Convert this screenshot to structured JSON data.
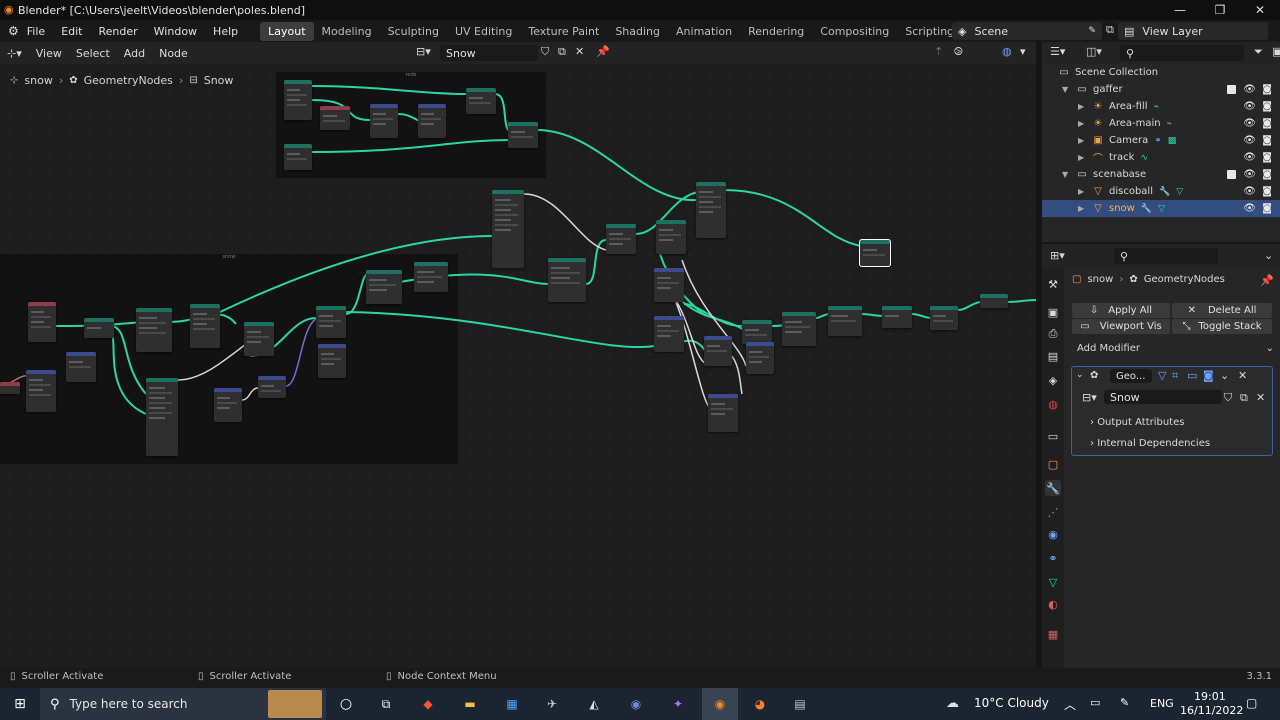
{
  "titlebar": {
    "title": "Blender* [C:\\Users\\jeelt\\Videos\\blender\\poles.blend]"
  },
  "menu": {
    "items": [
      "File",
      "Edit",
      "Render",
      "Window",
      "Help"
    ]
  },
  "workspaces": [
    "Layout",
    "Modeling",
    "Sculpting",
    "UV Editing",
    "Texture Paint",
    "Shading",
    "Animation",
    "Rendering",
    "Compositing",
    "Scripting",
    "+"
  ],
  "scene": {
    "name": "Scene"
  },
  "view_layer": {
    "name": "View Layer"
  },
  "node_editor": {
    "menu": [
      "View",
      "Select",
      "Add",
      "Node"
    ],
    "node_tree": "Snow",
    "breadcrumb": [
      "snow",
      "GeometryNodes",
      "Snow"
    ],
    "frame_top_label": "rods",
    "frame_left_label": "snow"
  },
  "outliner": {
    "root": "Scene Collection",
    "rows": [
      {
        "label": "gaffer",
        "type": "collection"
      },
      {
        "label": "Area-fill",
        "type": "light"
      },
      {
        "label": "Area-main",
        "type": "light"
      },
      {
        "label": "Camera",
        "type": "camera"
      },
      {
        "label": "track",
        "type": "curve"
      },
      {
        "label": "scenabase",
        "type": "collection"
      },
      {
        "label": "discoball",
        "type": "mesh"
      },
      {
        "label": "snow",
        "type": "mesh",
        "selected": true
      }
    ]
  },
  "properties": {
    "breadcrumb": [
      "snow",
      "GeometryNodes"
    ],
    "apply_all": "Apply All",
    "delete_all": "Delete All",
    "viewport_vis": "Viewport Vis",
    "toggle_stack": "Toggle Stack",
    "add_modifier": "Add Modifier",
    "modifier_name": "Geo...",
    "node_group": "Snow",
    "output_attributes": "Output Attributes",
    "internal_dependencies": "Internal Dependencies"
  },
  "statusbar": {
    "left1": "Scroller Activate",
    "left2": "Scroller Activate",
    "left3": "Node Context Menu",
    "version": "3.3.1"
  },
  "taskbar": {
    "search_placeholder": "Type here to search",
    "weather": "10°C  Cloudy",
    "lang": "ENG",
    "time": "19:01",
    "date": "16/11/2022"
  },
  "colors": {
    "accent_blue": "#334d80",
    "node_link": "#2bd6a4",
    "geometry_header": "#1d725e"
  }
}
